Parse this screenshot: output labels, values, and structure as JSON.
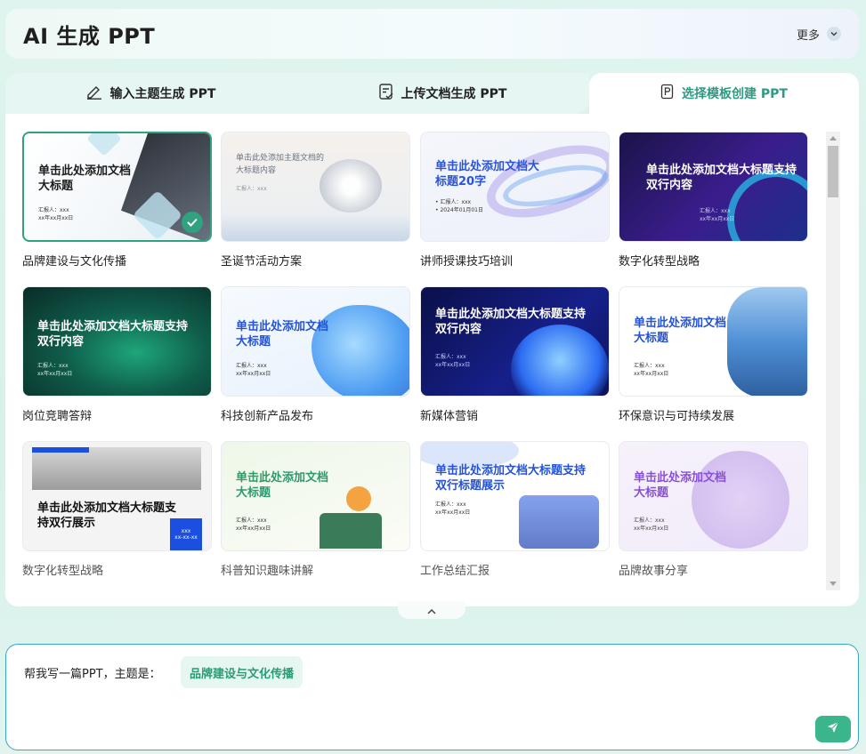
{
  "header": {
    "title": "AI 生成 PPT",
    "more_label": "更多"
  },
  "tabs": [
    {
      "label": "输入主题生成 PPT",
      "icon": "pen-icon"
    },
    {
      "label": "上传文档生成 PPT",
      "icon": "document-check-icon"
    },
    {
      "label": "选择模板创建 PPT",
      "icon": "ppt-file-icon",
      "active": true
    }
  ],
  "templates": [
    {
      "caption": "品牌建设与文化传播",
      "title": "单击此处添加文档大标题",
      "meta1": "汇报人：xxx",
      "meta2": "xx年xx月xx日",
      "selected": true,
      "theme": "brand"
    },
    {
      "caption": "圣诞节活动方案",
      "title": "单击此处添加主题文档的大标题内容",
      "meta1": "汇报人：xxx",
      "meta2": "",
      "theme": "flower"
    },
    {
      "caption": "讲师授课技巧培训",
      "title": "单击此处添加文档大标题20字",
      "meta1": "• 汇报人：xxx",
      "meta2": "• 2024年01月01日",
      "theme": "wave"
    },
    {
      "caption": "数字化转型战略",
      "title": "单击此处添加文档大标题支持双行内容",
      "meta1": "汇报人：xxx",
      "meta2": "xx年xx月xx日",
      "theme": "purple"
    },
    {
      "caption": "岗位竞聘答辩",
      "title": "单击此处添加文档大标题支持双行内容",
      "meta1": "汇报人：xxx",
      "meta2": "xx年xx月xx日",
      "theme": "green"
    },
    {
      "caption": "科技创新产品发布",
      "title": "单击此处添加文档大标题",
      "meta1": "汇报人：xxx",
      "meta2": "xx年xx月xx日",
      "theme": "glass"
    },
    {
      "caption": "新媒体营销",
      "title": "单击此处添加文档大标题支持双行内容",
      "meta1": "汇报人：xxx",
      "meta2": "xx年xx月xx日",
      "theme": "navy"
    },
    {
      "caption": "环保意识与可持续发展",
      "title": "单击此处添加文档大标题",
      "meta1": "汇报人：xxx",
      "meta2": "xx年xx月xx日",
      "theme": "city"
    },
    {
      "caption": "数字化转型战略",
      "title": "单击此处添加文档大标题支持双行展示",
      "meta1": "xxx",
      "meta2": "xx-xx-xx",
      "theme": "building",
      "dim": true
    },
    {
      "caption": "科普知识趣味讲解",
      "title": "单击此处添加文档大标题",
      "meta1": "汇报人：xxx",
      "meta2": "xx年xx月xx日",
      "theme": "plant",
      "dim": true
    },
    {
      "caption": "工作总结汇报",
      "title": "单击此处添加文档大标题支持双行标题展示",
      "meta1": "汇报人：xxx",
      "meta2": "xx年xx月xx日",
      "theme": "office",
      "dim": true
    },
    {
      "caption": "品牌故事分享",
      "title": "单击此处添加文档大标题",
      "meta1": "汇报人：xxx",
      "meta2": "xx年xx月xx日",
      "theme": "lilac",
      "dim": true
    }
  ],
  "prompt": {
    "prefix": "帮我写一篇PPT，主题是：",
    "topic": "品牌建设与文化传播"
  },
  "colors": {
    "accent": "#2fa37f",
    "border": "#35a7c0",
    "active_tab_text": "#2e9a82"
  }
}
